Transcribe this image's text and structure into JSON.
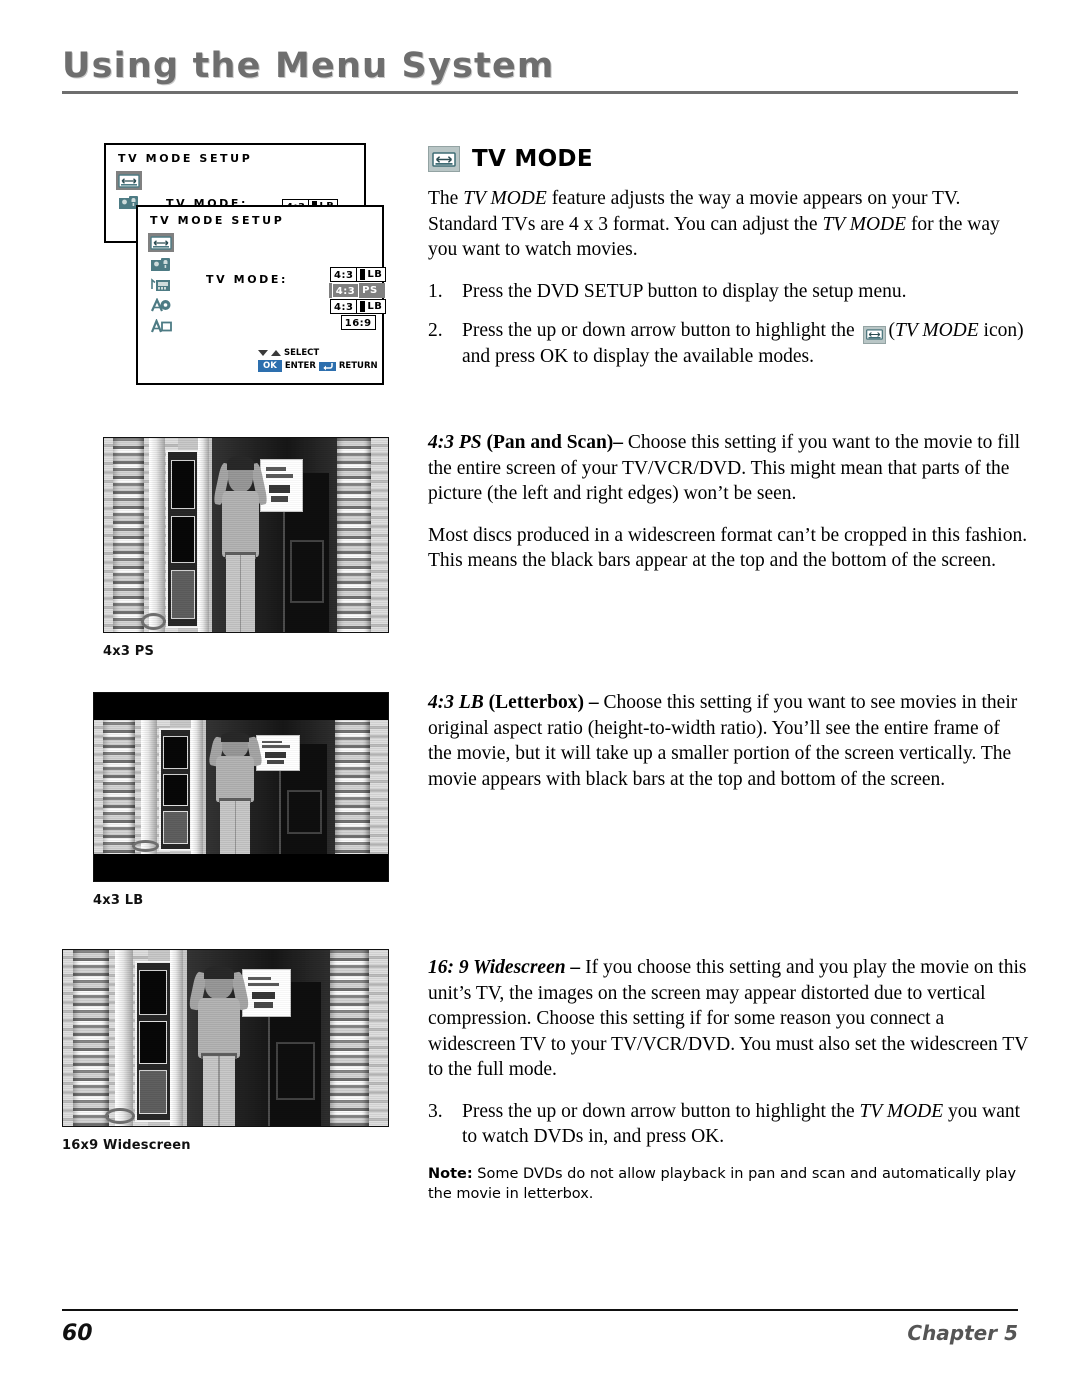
{
  "header": {
    "title": "Using the Menu System"
  },
  "osd": {
    "back_dialog": {
      "heading": "TV MODE SETUP",
      "field_label": "TV MODE:",
      "value_ratio": "4:3",
      "value_mode": "LB"
    },
    "front_dialog": {
      "heading": "TV MODE SETUP",
      "field_label": "TV MODE:",
      "options": [
        {
          "ratio": "4:3",
          "mode": "LB",
          "selected": false,
          "type": "lb"
        },
        {
          "ratio": "4:3",
          "mode": "PS",
          "selected": true,
          "type": "ps"
        },
        {
          "ratio": "4:3",
          "mode": "LB",
          "selected": false,
          "type": "lb"
        },
        {
          "ratio": "16:9",
          "mode": "",
          "selected": false,
          "type": "single"
        }
      ],
      "legend": {
        "select": "SELECT",
        "ok": "OK",
        "enter": "ENTER",
        "return": "RETURN"
      }
    },
    "icons": [
      "tv-mode-icon",
      "parental-lock-icon",
      "audio-setup-icon",
      "language-audio-icon",
      "subtitle-icon"
    ]
  },
  "section": {
    "icon": "tv-mode-icon",
    "title": "TV MODE",
    "intro_1": "The ",
    "intro_em1": "TV MODE",
    "intro_2": " feature adjusts the way a movie appears on your TV. Standard TVs are 4 x 3 format. You can adjust the ",
    "intro_em2": "TV MODE",
    "intro_3": " for the way you want to watch movies.",
    "steps": [
      {
        "num": "1.",
        "text": "Press the DVD SETUP button to display the setup menu."
      },
      {
        "num": "2.",
        "pre": "Press the up or down arrow button to highlight the ",
        "icon": "tv-mode-icon",
        "em": "TV MODE",
        "post_open": "(",
        "post": " icon) and press OK to display the available modes."
      }
    ]
  },
  "ps_block": {
    "lead_em": "4:3 PS",
    "lead_bold": " (Pan and Scan)–",
    "body": " Choose this setting if you want to the movie to fill the entire screen of your TV/VCR/DVD. This might mean that parts of the picture (the left and right edges) won’t be seen.",
    "para2": "Most discs produced in a widescreen format can’t be cropped in this fashion. This means the black bars appear at the top and the bottom of the screen."
  },
  "lb_block": {
    "lead_em": "4:3 LB",
    "lead_bold": " (Letterbox) –",
    "body": " Choose this setting if you want to see movies in their original aspect ratio (height-to-width ratio). You’ll see the entire frame of the movie, but it will take up a smaller portion of the screen vertically. The movie appears with black bars at the top and bottom of the screen."
  },
  "ws_block": {
    "lead_em": "16: 9 Widescreen –",
    "body": "  If you choose this setting and you play the movie on this unit’s TV, the images on the screen may appear distorted due to vertical compression. Choose this setting if for some reason you connect a widescreen TV to your TV/VCR/DVD. You must also set the widescreen TV to the full mode.",
    "step_num": "3.",
    "step_pre": "Press the up or down arrow button to highlight the ",
    "step_em": "TV MODE",
    "step_post": " you want to watch DVDs in, and press OK.",
    "note_label": "Note:",
    "note_text": " Some DVDs do not allow playback in pan and scan and automatically play the movie in letterbox."
  },
  "figures": [
    {
      "caption": "4x3 PS",
      "name": "tv-photo-pan-and-scan"
    },
    {
      "caption": "4x3 LB",
      "name": "tv-photo-letterbox"
    },
    {
      "caption": "16x9 Widescreen",
      "name": "tv-photo-widescreen"
    }
  ],
  "footer": {
    "page_number": "60",
    "chapter": "Chapter 5"
  },
  "colors": {
    "header_gray": "#6e6e6e",
    "icon_teal": "#4d7b84",
    "highlight_gray": "#808080",
    "badge_blue": "#2d6fae",
    "section_icon_bg": "#b9c6c6"
  }
}
